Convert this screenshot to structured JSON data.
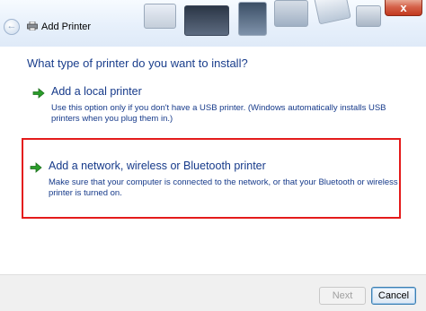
{
  "window": {
    "title": "Add Printer",
    "close_symbol": "x"
  },
  "nav": {
    "back_symbol": "←"
  },
  "main": {
    "heading": "What type of printer do you want to install?",
    "options": [
      {
        "title": "Add a local printer",
        "description": "Use this option only if you don't have a USB printer. (Windows automatically installs USB printers when you plug them in.)",
        "icon": "green-arrow-icon"
      },
      {
        "title": "Add a network, wireless or Bluetooth printer",
        "description": "Make sure that your computer is connected to the network, or that your Bluetooth or wireless printer is turned on.",
        "icon": "green-arrow-icon",
        "highlighted": true
      }
    ]
  },
  "footer": {
    "next_label": "Next",
    "cancel_label": "Cancel"
  },
  "colors": {
    "link_blue": "#163a8a",
    "heading_blue": "#1a3e8c",
    "highlight_red": "#e41b1b",
    "arrow_green": "#2a9d2a"
  }
}
